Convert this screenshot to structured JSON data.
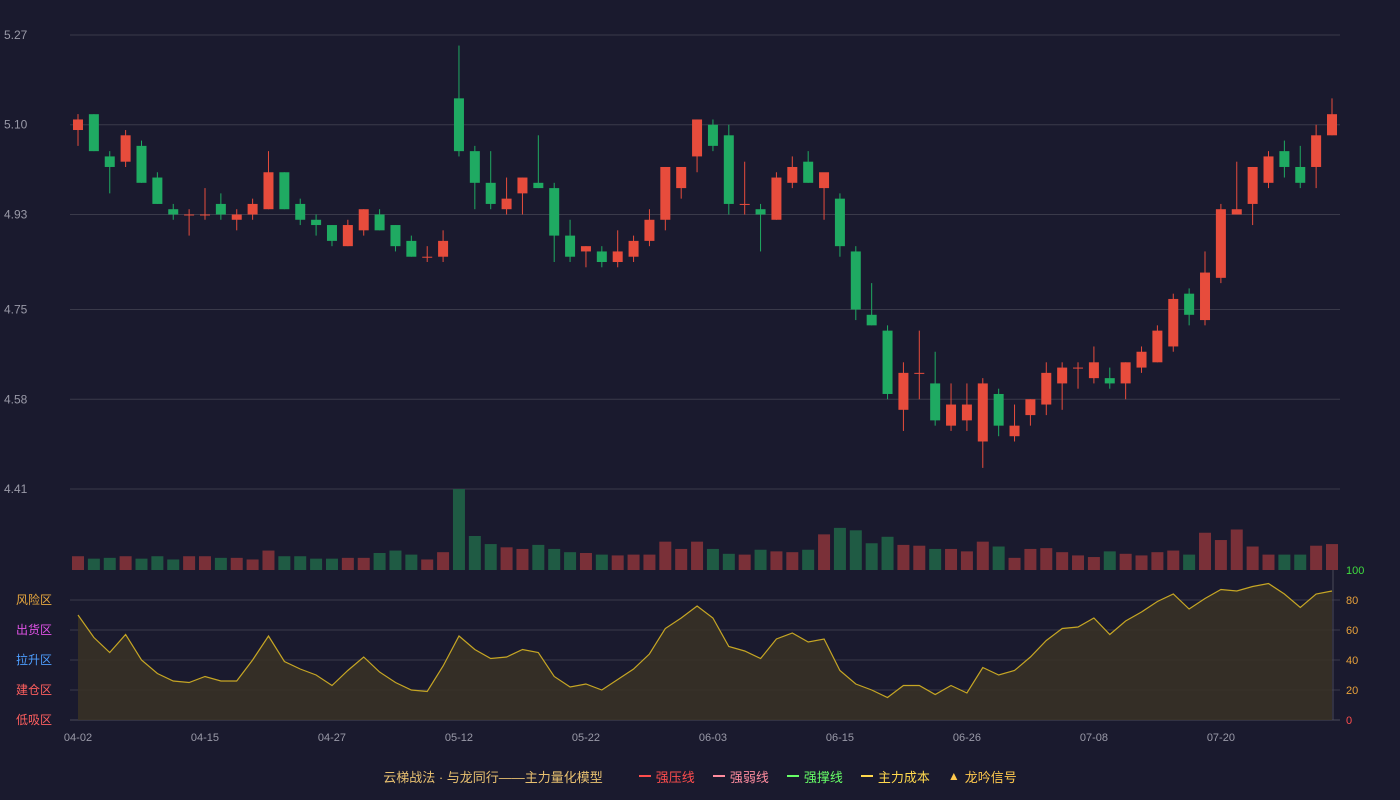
{
  "chart_data": {
    "type": "candlestick",
    "title": "",
    "price_axis": {
      "ticks": [
        "4.41",
        "4.58",
        "4.75",
        "4.93",
        "5.10",
        "5.27"
      ],
      "min": 4.41,
      "max": 5.27
    },
    "x_ticks": [
      {
        "index": 0,
        "label": "04-02"
      },
      {
        "index": 8,
        "label": "04-15"
      },
      {
        "index": 16,
        "label": "04-27"
      },
      {
        "index": 24,
        "label": "05-12"
      },
      {
        "index": 32,
        "label": "05-22"
      },
      {
        "index": 40,
        "label": "06-03"
      },
      {
        "index": 48,
        "label": "06-15"
      },
      {
        "index": 56,
        "label": "06-26"
      },
      {
        "index": 64,
        "label": "07-08"
      },
      {
        "index": 72,
        "label": "07-20"
      }
    ],
    "ohlc": [
      [
        5.09,
        5.12,
        5.06,
        5.11
      ],
      [
        5.12,
        5.12,
        5.05,
        5.05
      ],
      [
        5.04,
        5.05,
        4.97,
        5.02
      ],
      [
        5.03,
        5.09,
        5.02,
        5.08
      ],
      [
        5.06,
        5.07,
        4.99,
        4.99
      ],
      [
        5.0,
        5.01,
        4.95,
        4.95
      ],
      [
        4.94,
        4.95,
        4.92,
        4.93
      ],
      [
        4.93,
        4.94,
        4.89,
        4.93
      ],
      [
        4.93,
        4.98,
        4.92,
        4.93
      ],
      [
        4.95,
        4.97,
        4.92,
        4.93
      ],
      [
        4.92,
        4.94,
        4.9,
        4.93
      ],
      [
        4.93,
        4.96,
        4.92,
        4.95
      ],
      [
        4.94,
        5.05,
        4.94,
        5.01
      ],
      [
        5.01,
        5.01,
        4.94,
        4.94
      ],
      [
        4.95,
        4.96,
        4.91,
        4.92
      ],
      [
        4.92,
        4.93,
        4.89,
        4.91
      ],
      [
        4.91,
        4.91,
        4.87,
        4.88
      ],
      [
        4.87,
        4.92,
        4.87,
        4.91
      ],
      [
        4.9,
        4.94,
        4.89,
        4.94
      ],
      [
        4.93,
        4.94,
        4.9,
        4.9
      ],
      [
        4.91,
        4.91,
        4.86,
        4.87
      ],
      [
        4.88,
        4.89,
        4.85,
        4.85
      ],
      [
        4.85,
        4.87,
        4.84,
        4.85
      ],
      [
        4.85,
        4.9,
        4.84,
        4.88
      ],
      [
        5.15,
        5.25,
        5.04,
        5.05
      ],
      [
        5.05,
        5.06,
        4.94,
        4.99
      ],
      [
        4.99,
        5.05,
        4.94,
        4.95
      ],
      [
        4.94,
        5.0,
        4.93,
        4.96
      ],
      [
        4.97,
        5.0,
        4.93,
        5.0
      ],
      [
        4.99,
        5.08,
        4.98,
        4.98
      ],
      [
        4.98,
        4.99,
        4.84,
        4.89
      ],
      [
        4.89,
        4.92,
        4.84,
        4.85
      ],
      [
        4.86,
        4.87,
        4.83,
        4.87
      ],
      [
        4.86,
        4.87,
        4.83,
        4.84
      ],
      [
        4.84,
        4.9,
        4.83,
        4.86
      ],
      [
        4.85,
        4.89,
        4.84,
        4.88
      ],
      [
        4.88,
        4.94,
        4.87,
        4.92
      ],
      [
        4.92,
        5.02,
        4.9,
        5.02
      ],
      [
        4.98,
        5.02,
        4.96,
        5.02
      ],
      [
        5.04,
        5.11,
        5.01,
        5.11
      ],
      [
        5.1,
        5.11,
        5.05,
        5.06
      ],
      [
        5.08,
        5.1,
        4.93,
        4.95
      ],
      [
        4.95,
        5.03,
        4.93,
        4.95
      ],
      [
        4.94,
        4.95,
        4.86,
        4.93
      ],
      [
        4.92,
        5.01,
        4.92,
        5.0
      ],
      [
        4.99,
        5.04,
        4.98,
        5.02
      ],
      [
        5.03,
        5.05,
        4.99,
        4.99
      ],
      [
        4.98,
        5.0,
        4.92,
        5.01
      ],
      [
        4.96,
        4.97,
        4.85,
        4.87
      ],
      [
        4.86,
        4.87,
        4.73,
        4.75
      ],
      [
        4.74,
        4.8,
        4.72,
        4.72
      ],
      [
        4.71,
        4.72,
        4.58,
        4.59
      ],
      [
        4.56,
        4.65,
        4.52,
        4.63
      ],
      [
        4.63,
        4.71,
        4.58,
        4.63
      ],
      [
        4.61,
        4.67,
        4.53,
        4.54
      ],
      [
        4.53,
        4.61,
        4.52,
        4.57
      ],
      [
        4.54,
        4.61,
        4.52,
        4.57
      ],
      [
        4.5,
        4.62,
        4.45,
        4.61
      ],
      [
        4.59,
        4.6,
        4.51,
        4.53
      ],
      [
        4.51,
        4.57,
        4.5,
        4.53
      ],
      [
        4.55,
        4.58,
        4.53,
        4.58
      ],
      [
        4.57,
        4.65,
        4.55,
        4.63
      ],
      [
        4.61,
        4.65,
        4.56,
        4.64
      ],
      [
        4.64,
        4.65,
        4.6,
        4.64
      ],
      [
        4.62,
        4.68,
        4.61,
        4.65
      ],
      [
        4.62,
        4.64,
        4.6,
        4.61
      ],
      [
        4.61,
        4.65,
        4.58,
        4.65
      ],
      [
        4.64,
        4.68,
        4.63,
        4.67
      ],
      [
        4.65,
        4.72,
        4.65,
        4.71
      ],
      [
        4.68,
        4.78,
        4.67,
        4.77
      ],
      [
        4.78,
        4.79,
        4.72,
        4.74
      ],
      [
        4.73,
        4.86,
        4.72,
        4.82
      ],
      [
        4.81,
        4.95,
        4.8,
        4.94
      ],
      [
        4.93,
        5.03,
        4.93,
        4.94
      ],
      [
        4.95,
        5.02,
        4.91,
        5.02
      ],
      [
        4.99,
        5.05,
        4.98,
        5.04
      ],
      [
        5.05,
        5.07,
        5.0,
        5.02
      ],
      [
        5.02,
        5.06,
        4.98,
        4.99
      ],
      [
        5.02,
        5.1,
        4.98,
        5.08
      ],
      [
        5.08,
        5.15,
        5.08,
        5.12
      ]
    ],
    "volume": [
      17,
      14,
      15,
      17,
      14,
      17,
      13,
      17,
      17,
      15,
      15,
      13,
      24,
      17,
      17,
      14,
      14,
      15,
      15,
      21,
      24,
      19,
      13,
      22,
      100,
      42,
      32,
      28,
      26,
      31,
      26,
      22,
      21,
      19,
      18,
      19,
      19,
      35,
      26,
      35,
      26,
      20,
      19,
      25,
      23,
      22,
      25,
      44,
      52,
      49,
      33,
      41,
      31,
      30,
      26,
      26,
      23,
      35,
      29,
      15,
      26,
      27,
      22,
      18,
      16,
      23,
      20,
      18,
      22,
      24,
      19,
      46,
      37,
      50,
      29,
      19,
      19,
      19,
      30,
      32
    ],
    "volume_max": 100,
    "indicator": {
      "name": "",
      "values": [
        70,
        55,
        45,
        57,
        40,
        31,
        26,
        25,
        29,
        26,
        26,
        40,
        56,
        39,
        34,
        30,
        23,
        33,
        42,
        32,
        25,
        20,
        19,
        36,
        56,
        47,
        41,
        42,
        47,
        45,
        29,
        22,
        24,
        20,
        27,
        34,
        44,
        61,
        68,
        76,
        68,
        49,
        46,
        41,
        54,
        58,
        52,
        54,
        33,
        24,
        20,
        15,
        23,
        23,
        17,
        23,
        18,
        35,
        30,
        33,
        42,
        53,
        61,
        62,
        68,
        57,
        66,
        72,
        79,
        84,
        74,
        81,
        87,
        86,
        89,
        91,
        84,
        75,
        84,
        86
      ],
      "axis_ticks": [
        "0",
        "20",
        "40",
        "60",
        "80",
        "100"
      ],
      "zones": [
        {
          "label": "风险区",
          "value": 80,
          "color": "#e9a83e"
        },
        {
          "label": "出货区",
          "value": 60,
          "color": "#e052e6"
        },
        {
          "label": "拉升区",
          "value": 40,
          "color": "#4d9eff"
        },
        {
          "label": "建仓区",
          "value": 20,
          "color": "#ff5f5f"
        },
        {
          "label": "低吸区",
          "value": 0,
          "color": "#ff5f5f"
        }
      ]
    },
    "grid": true,
    "colors": {
      "up": "#e74c3c",
      "down": "#1faa62",
      "grid": "#3a3a4a",
      "axis_text": "#9a9aa8",
      "line": "#c6a624"
    }
  },
  "footer": {
    "title": "云梯战法 · 与龙同行——主力量化模型",
    "legend": [
      {
        "label": "强压线",
        "color": "#ff4d4d",
        "style": "solid",
        "glyph": ""
      },
      {
        "label": "强弱线",
        "color": "#ff8c9e",
        "style": "dashed",
        "glyph": ""
      },
      {
        "label": "强撑线",
        "color": "#67ff67",
        "style": "solid",
        "glyph": ""
      },
      {
        "label": "主力成本",
        "color": "#ffd84d",
        "style": "dashed",
        "glyph": ""
      },
      {
        "label": "龙吟信号",
        "color": "#ffc94d",
        "style": "glyph",
        "glyph": "▲"
      }
    ]
  }
}
